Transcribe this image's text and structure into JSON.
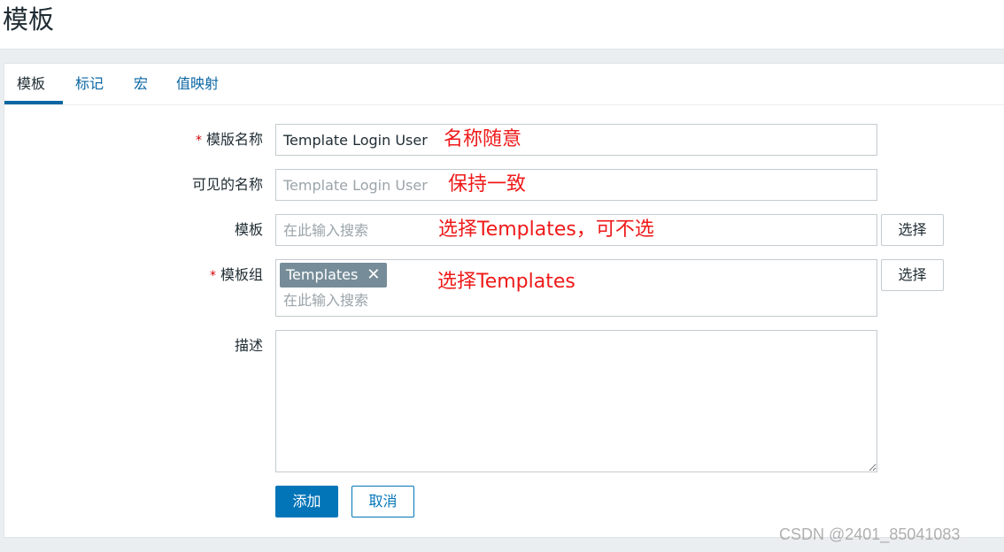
{
  "page": {
    "title": "模板"
  },
  "tabs": [
    {
      "label": "模板",
      "active": true
    },
    {
      "label": "标记",
      "active": false
    },
    {
      "label": "宏",
      "active": false
    },
    {
      "label": "值映射",
      "active": false
    }
  ],
  "form": {
    "template_name": {
      "label": "模版名称",
      "required_mark": "*",
      "value": "Template Login User",
      "annotation": "名称随意"
    },
    "visible_name": {
      "label": "可见的名称",
      "placeholder": "Template Login User",
      "annotation": "保持一致"
    },
    "templates": {
      "label": "模板",
      "placeholder": "在此输入搜索",
      "select_button": "选择",
      "annotation": "选择Templates，可不选"
    },
    "template_groups": {
      "label": "模板组",
      "required_mark": "*",
      "selected_tag": "Templates",
      "tag_remove": "✕",
      "placeholder": "在此输入搜索",
      "select_button": "选择",
      "annotation": "选择Templates"
    },
    "description": {
      "label": "描述",
      "value": ""
    }
  },
  "actions": {
    "add_label": "添加",
    "cancel_label": "取消"
  },
  "watermark": "CSDN @2401_85041083",
  "colors": {
    "accent": "#0275b8",
    "annotation": "#ef1a1a",
    "tag_bg": "#768d99",
    "required": "#d40000"
  }
}
